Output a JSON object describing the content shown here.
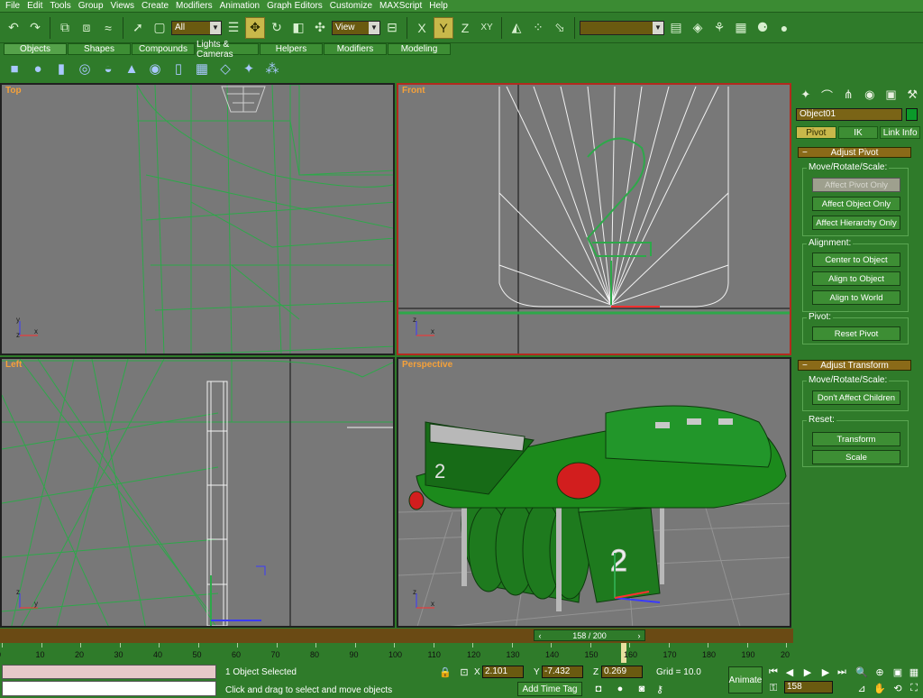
{
  "menu": [
    "File",
    "Edit",
    "Tools",
    "Group",
    "Views",
    "Create",
    "Modifiers",
    "Animation",
    "Graph Editors",
    "Customize",
    "MAXScript",
    "Help"
  ],
  "toolbar": {
    "selection_filter": "All",
    "ref_coord": "View",
    "axis_x": "X",
    "axis_y": "Y",
    "axis_z": "Z",
    "axis_xy": "XY"
  },
  "tabs": [
    "Objects",
    "Shapes",
    "Compounds",
    "Lights & Cameras",
    "Helpers",
    "Modifiers",
    "Modeling"
  ],
  "viewports": {
    "top": "Top",
    "front": "Front",
    "left": "Left",
    "perspective": "Perspective",
    "axis_labels": {
      "x": "x",
      "y": "y",
      "z": "z"
    }
  },
  "command_panel": {
    "object_name": "Object01",
    "object_color": "#0a9a2a",
    "hier_tabs": [
      "Pivot",
      "IK",
      "Link Info"
    ],
    "adjust_pivot": {
      "title": "Adjust Pivot",
      "move_group": "Move/Rotate/Scale:",
      "affect_pivot_only": "Affect Pivot Only",
      "affect_object_only": "Affect Object Only",
      "affect_hierarchy_only": "Affect Hierarchy Only",
      "alignment_group": "Alignment:",
      "center_to_object": "Center to Object",
      "align_to_object": "Align to Object",
      "align_to_world": "Align to World",
      "pivot_group": "Pivot:",
      "reset_pivot": "Reset Pivot"
    },
    "adjust_transform": {
      "title": "Adjust Transform",
      "move_group": "Move/Rotate/Scale:",
      "dont_affect_children": "Don't Affect Children",
      "reset_group": "Reset:",
      "transform": "Transform",
      "scale": "Scale"
    }
  },
  "time": {
    "slider_label": "158 / 200",
    "current_frame": "158",
    "ticks": [
      "0",
      "10",
      "20",
      "30",
      "40",
      "50",
      "60",
      "70",
      "80",
      "90",
      "100",
      "110",
      "120",
      "130",
      "140",
      "150",
      "160",
      "170",
      "180",
      "190",
      "20"
    ]
  },
  "status": {
    "selection": "1 Object Selected",
    "prompt": "Click and drag to select and move objects",
    "x_label": "X",
    "x_value": "2.101",
    "y_label": "Y",
    "y_value": "-7.432",
    "z_label": "Z",
    "z_value": "0.269",
    "grid": "Grid = 10.0",
    "add_time_tag": "Add Time Tag",
    "animate": "Animate"
  },
  "colors": {
    "ui_green": "#2f7b2a",
    "viewport_grey": "#787878",
    "wire_green": "#2ea84a",
    "active_border": "#b22a1e",
    "label_orange": "#f5a13a"
  }
}
